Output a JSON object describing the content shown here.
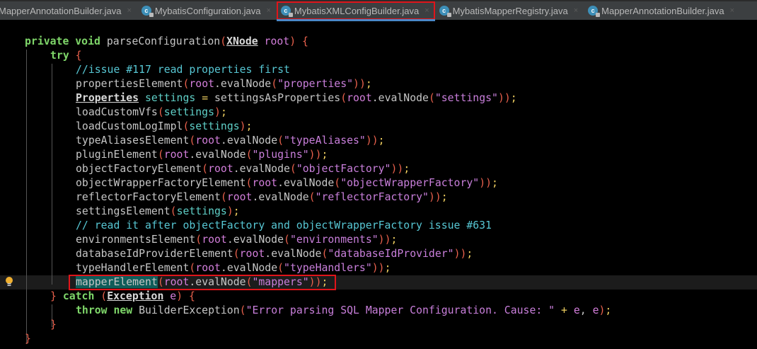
{
  "tabs": [
    {
      "label": "MapperAnnotationBuilder.java",
      "icon": false,
      "active": false
    },
    {
      "label": "MybatisConfiguration.java",
      "icon": true,
      "active": false
    },
    {
      "label": "MybatisXMLConfigBuilder.java",
      "icon": true,
      "active": true
    },
    {
      "label": "MybatisMapperRegistry.java",
      "icon": true,
      "active": false
    },
    {
      "label": "MapperAnnotationBuilder.java",
      "icon": true,
      "active": false
    }
  ],
  "close_glyph": "×",
  "code": [
    {
      "indent": 0,
      "tokens": [
        [
          "private void ",
          "kw"
        ],
        [
          "parseConfiguration",
          "d"
        ],
        [
          "(",
          "p"
        ],
        [
          "XNode",
          "ty"
        ],
        [
          " root",
          "v"
        ],
        [
          ")",
          "p"
        ],
        [
          " {",
          "p"
        ]
      ]
    },
    {
      "indent": 1,
      "tokens": [
        [
          "try",
          "kw"
        ],
        [
          " {",
          "p"
        ]
      ]
    },
    {
      "indent": 2,
      "tokens": [
        [
          "//issue #117 read properties first",
          "cm"
        ]
      ]
    },
    {
      "indent": 2,
      "tokens": [
        [
          "propertiesElement",
          "d"
        ],
        [
          "(",
          "p"
        ],
        [
          "root",
          "v"
        ],
        [
          ".evalNode",
          "d"
        ],
        [
          "(",
          "p"
        ],
        [
          "\"properties\"",
          "s"
        ],
        [
          "))",
          "p"
        ],
        [
          ";",
          "op"
        ]
      ]
    },
    {
      "indent": 2,
      "tokens": [
        [
          "Properties",
          "ty"
        ],
        [
          " settings ",
          "lv"
        ],
        [
          "=",
          "op"
        ],
        [
          " settingsAsProperties",
          "d"
        ],
        [
          "(",
          "p"
        ],
        [
          "root",
          "v"
        ],
        [
          ".evalNode",
          "d"
        ],
        [
          "(",
          "p"
        ],
        [
          "\"settings\"",
          "s"
        ],
        [
          "))",
          "p"
        ],
        [
          ";",
          "op"
        ]
      ]
    },
    {
      "indent": 2,
      "tokens": [
        [
          "loadCustomVfs",
          "d"
        ],
        [
          "(",
          "p"
        ],
        [
          "settings",
          "lv"
        ],
        [
          ")",
          "p"
        ],
        [
          ";",
          "op"
        ]
      ]
    },
    {
      "indent": 2,
      "tokens": [
        [
          "loadCustomLogImpl",
          "d"
        ],
        [
          "(",
          "p"
        ],
        [
          "settings",
          "lv"
        ],
        [
          ")",
          "p"
        ],
        [
          ";",
          "op"
        ]
      ]
    },
    {
      "indent": 2,
      "tokens": [
        [
          "typeAliasesElement",
          "d"
        ],
        [
          "(",
          "p"
        ],
        [
          "root",
          "v"
        ],
        [
          ".evalNode",
          "d"
        ],
        [
          "(",
          "p"
        ],
        [
          "\"typeAliases\"",
          "s"
        ],
        [
          "))",
          "p"
        ],
        [
          ";",
          "op"
        ]
      ]
    },
    {
      "indent": 2,
      "tokens": [
        [
          "pluginElement",
          "d"
        ],
        [
          "(",
          "p"
        ],
        [
          "root",
          "v"
        ],
        [
          ".evalNode",
          "d"
        ],
        [
          "(",
          "p"
        ],
        [
          "\"plugins\"",
          "s"
        ],
        [
          "))",
          "p"
        ],
        [
          ";",
          "op"
        ]
      ]
    },
    {
      "indent": 2,
      "tokens": [
        [
          "objectFactoryElement",
          "d"
        ],
        [
          "(",
          "p"
        ],
        [
          "root",
          "v"
        ],
        [
          ".evalNode",
          "d"
        ],
        [
          "(",
          "p"
        ],
        [
          "\"objectFactory\"",
          "s"
        ],
        [
          "))",
          "p"
        ],
        [
          ";",
          "op"
        ]
      ]
    },
    {
      "indent": 2,
      "tokens": [
        [
          "objectWrapperFactoryElement",
          "d"
        ],
        [
          "(",
          "p"
        ],
        [
          "root",
          "v"
        ],
        [
          ".evalNode",
          "d"
        ],
        [
          "(",
          "p"
        ],
        [
          "\"objectWrapperFactory\"",
          "s"
        ],
        [
          "))",
          "p"
        ],
        [
          ";",
          "op"
        ]
      ]
    },
    {
      "indent": 2,
      "tokens": [
        [
          "reflectorFactoryElement",
          "d"
        ],
        [
          "(",
          "p"
        ],
        [
          "root",
          "v"
        ],
        [
          ".evalNode",
          "d"
        ],
        [
          "(",
          "p"
        ],
        [
          "\"reflectorFactory\"",
          "s"
        ],
        [
          "))",
          "p"
        ],
        [
          ";",
          "op"
        ]
      ]
    },
    {
      "indent": 2,
      "tokens": [
        [
          "settingsElement",
          "d"
        ],
        [
          "(",
          "p"
        ],
        [
          "settings",
          "lv"
        ],
        [
          ")",
          "p"
        ],
        [
          ";",
          "op"
        ]
      ]
    },
    {
      "indent": 2,
      "tokens": [
        [
          "// read it after objectFactory and objectWrapperFactory issue #631",
          "cm"
        ]
      ]
    },
    {
      "indent": 2,
      "tokens": [
        [
          "environmentsElement",
          "d"
        ],
        [
          "(",
          "p"
        ],
        [
          "root",
          "v"
        ],
        [
          ".evalNode",
          "d"
        ],
        [
          "(",
          "p"
        ],
        [
          "\"environments\"",
          "s"
        ],
        [
          "))",
          "p"
        ],
        [
          ";",
          "op"
        ]
      ]
    },
    {
      "indent": 2,
      "tokens": [
        [
          "databaseIdProviderElement",
          "d"
        ],
        [
          "(",
          "p"
        ],
        [
          "root",
          "v"
        ],
        [
          ".evalNode",
          "d"
        ],
        [
          "(",
          "p"
        ],
        [
          "\"databaseIdProvider\"",
          "s"
        ],
        [
          "))",
          "p"
        ],
        [
          ";",
          "op"
        ]
      ]
    },
    {
      "indent": 2,
      "tokens": [
        [
          "typeHandlerElement",
          "d"
        ],
        [
          "(",
          "p"
        ],
        [
          "root",
          "v"
        ],
        [
          ".evalNode",
          "d"
        ],
        [
          "(",
          "p"
        ],
        [
          "\"typeHandlers\"",
          "s"
        ],
        [
          "))",
          "p"
        ],
        [
          ";",
          "op"
        ]
      ]
    },
    {
      "indent": 2,
      "tokens": [
        [
          "mapperElement",
          "hl"
        ],
        [
          "(",
          "p"
        ],
        [
          "root",
          "v"
        ],
        [
          ".evalNode",
          "d"
        ],
        [
          "(",
          "p"
        ],
        [
          "\"mappers\"",
          "s"
        ],
        [
          "))",
          "p"
        ],
        [
          ";",
          "op"
        ]
      ]
    },
    {
      "indent": 1,
      "tokens": [
        [
          "}",
          "p"
        ],
        [
          " catch ",
          "kw"
        ],
        [
          "(",
          "p"
        ],
        [
          "Exception",
          "ty"
        ],
        [
          " e",
          "v"
        ],
        [
          ")",
          "p"
        ],
        [
          " {",
          "p"
        ]
      ]
    },
    {
      "indent": 2,
      "tokens": [
        [
          "throw new ",
          "kw"
        ],
        [
          "BuilderException",
          "d"
        ],
        [
          "(",
          "p"
        ],
        [
          "\"Error parsing SQL Mapper Configuration. Cause: \"",
          "s"
        ],
        [
          " + ",
          "op"
        ],
        [
          "e",
          "v"
        ],
        [
          ", ",
          "d"
        ],
        [
          "e",
          "v"
        ],
        [
          ")",
          "p"
        ],
        [
          ";",
          "op"
        ]
      ]
    },
    {
      "indent": 1,
      "tokens": [
        [
          "}",
          "p"
        ]
      ]
    },
    {
      "indent": 0,
      "tokens": [
        [
          "}",
          "p"
        ]
      ]
    }
  ]
}
